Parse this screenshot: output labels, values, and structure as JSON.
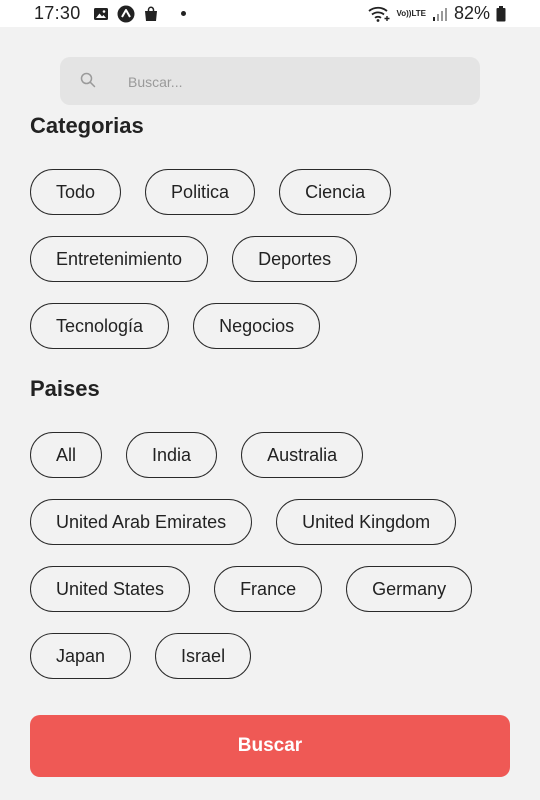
{
  "status_bar": {
    "time": "17:30",
    "battery_percent": "82%",
    "network_label": "LTE",
    "icons": [
      "image-icon",
      "app-icon",
      "shopping-bag-icon",
      "notification-dot",
      "wifi-icon",
      "volte-icon",
      "signal-icon",
      "battery-icon"
    ]
  },
  "search": {
    "placeholder": "Buscar...",
    "value": ""
  },
  "categories": {
    "title": "Categorias",
    "items": [
      "Todo",
      "Politica",
      "Ciencia",
      "Entretenimiento",
      "Deportes",
      "Tecnología",
      "Negocios"
    ]
  },
  "countries": {
    "title": "Paises",
    "items": [
      "All",
      "India",
      "Australia",
      "United Arab Emirates",
      "United Kingdom",
      "United States",
      "France",
      "Germany",
      "Japan",
      "Israel"
    ]
  },
  "submit": {
    "label": "Buscar",
    "color": "#ef5955"
  }
}
